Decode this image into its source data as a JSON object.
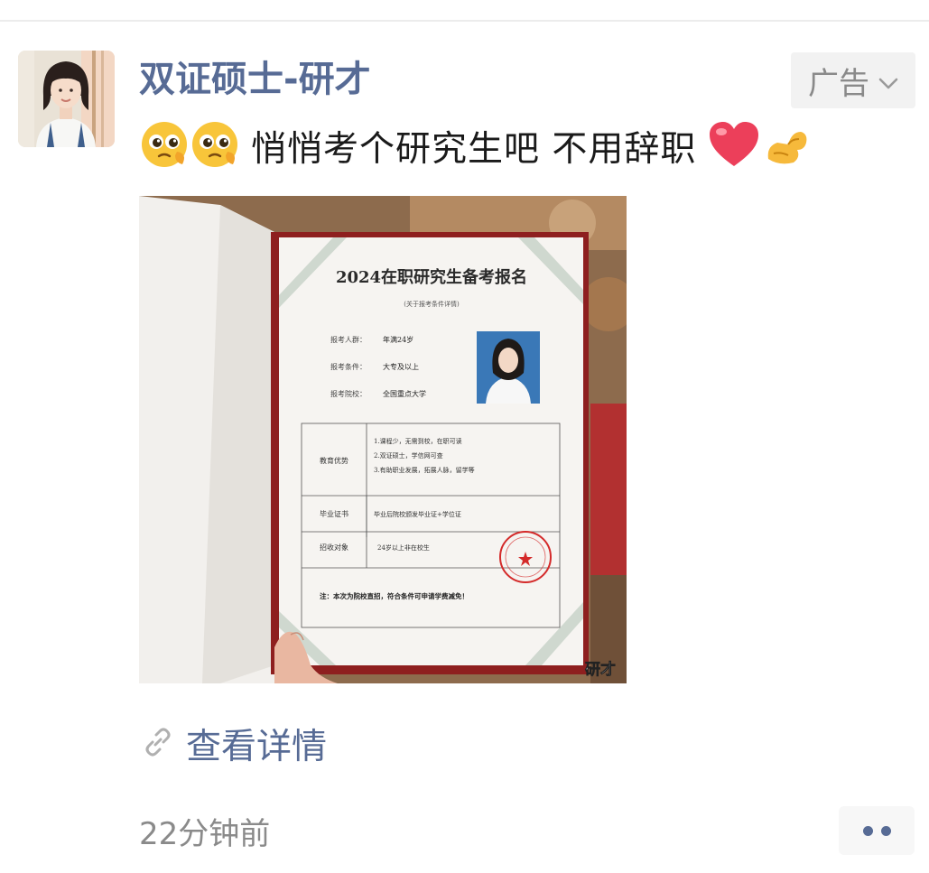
{
  "post": {
    "author": "双证硕士-研才",
    "ad_label": "广告",
    "caption": "悄悄考个研究生吧 不用辞职",
    "details_link": "查看详情",
    "timestamp": "22分钟前"
  },
  "icons": {
    "caption_emojis": [
      "pleading-face-icon",
      "pleading-face-icon",
      "red-heart-icon",
      "flexed-biceps-icon"
    ],
    "ad_dropdown": "chevron-down-icon",
    "link": "link-icon",
    "more": "more-dots-icon"
  },
  "certificate": {
    "title": "2024在职研究生备考报名",
    "subtitle": "(关于报考条件详情)",
    "fields": [
      {
        "label": "报考人群：",
        "value": "年满24岁"
      },
      {
        "label": "报考条件：",
        "value": "大专及以上"
      },
      {
        "label": "报考院校：",
        "value": "全国重点大学"
      }
    ],
    "table": [
      {
        "label": "教育优势",
        "lines": [
          "1.课程少，无需到校，在职可读",
          "2.双证硕士，学信网可查",
          "3.有助职业发展，拓展人脉，留学等"
        ]
      },
      {
        "label": "毕业证书",
        "lines": [
          "毕业后院校颁发毕业证+学位证"
        ]
      },
      {
        "label": "招收对象",
        "lines": [
          "24岁以上非在校生"
        ]
      }
    ],
    "note": "注：本次为院校直招，符合条件可申请学费减免！",
    "watermark": "研才"
  },
  "colors": {
    "link_blue": "#576b95",
    "text": "#1a1a1a",
    "muted": "#8a8a8a",
    "folder_red": "#8e1f1f",
    "stamp_red": "#d42a2a"
  }
}
